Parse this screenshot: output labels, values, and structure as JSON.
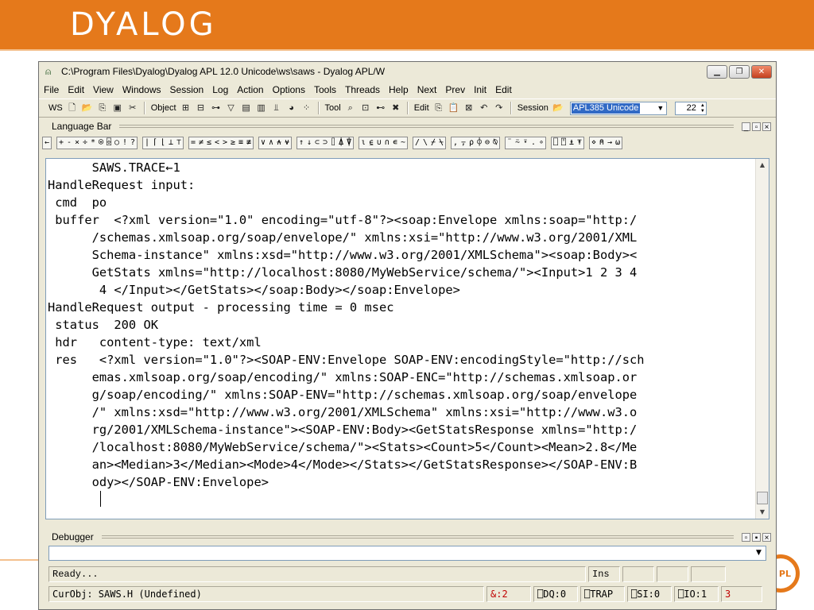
{
  "slide": {
    "logo": "DYALOG",
    "badge": "PL"
  },
  "window": {
    "title": "C:\\Program Files\\Dyalog\\Dyalog APL 12.0 Unicode\\ws\\saws - Dyalog APL/W",
    "minimize": "▁",
    "restore": "❐",
    "close": "✕"
  },
  "menu": [
    "File",
    "Edit",
    "View",
    "Windows",
    "Session",
    "Log",
    "Action",
    "Options",
    "Tools",
    "Threads",
    "Help",
    "Next",
    "Prev",
    "Init",
    "Edit"
  ],
  "toolbar": {
    "ws_label": "WS",
    "object_label": "Object",
    "tool_label": "Tool",
    "edit_label": "Edit",
    "session_label": "Session",
    "font_value": "APL385 Unicode",
    "font_size": "22"
  },
  "language_bar": {
    "title": "Language Bar",
    "groups": [
      [
        "←"
      ],
      [
        "+",
        "-",
        "×",
        "÷",
        "*",
        "⍟",
        "⌹",
        "○",
        "!",
        "?"
      ],
      [
        "|",
        "⌈",
        "⌊",
        "⊥",
        "⊤"
      ],
      [
        "=",
        "≠",
        "≤",
        "<",
        ">",
        "≥",
        "≡",
        "≢"
      ],
      [
        "∨",
        "∧",
        "⍲",
        "⍱"
      ],
      [
        "↑",
        "↓",
        "⊂",
        "⊃",
        "⌷",
        "⍋",
        "⍒"
      ],
      [
        "⍳",
        "⍷",
        "∪",
        "∩",
        "∊",
        "~"
      ],
      [
        "/",
        "\\",
        "⌿",
        "⍀"
      ],
      [
        ",",
        "⍪",
        "⍴",
        "⌽",
        "⊖",
        "⍉"
      ],
      [
        "¨",
        "⍨",
        "⍣",
        ".",
        "∘"
      ],
      [
        "⎕",
        "⍞",
        "⍎",
        "⍕"
      ],
      [
        "⋄",
        "⍝",
        "→",
        "⍵"
      ]
    ]
  },
  "session_lines": [
    "      SAWS.TRACE←1",
    "HandleRequest input:",
    " cmd  po",
    " buffer  <?xml version=\"1.0\" encoding=\"utf-8\"?><soap:Envelope xmlns:soap=\"http:/",
    "      /schemas.xmlsoap.org/soap/envelope/\" xmlns:xsi=\"http://www.w3.org/2001/XML",
    "      Schema-instance\" xmlns:xsd=\"http://www.w3.org/2001/XMLSchema\"><soap:Body><",
    "      GetStats xmlns=\"http://localhost:8080/MyWebService/schema/\"><Input>1 2 3 4",
    "       4 </Input></GetStats></soap:Body></soap:Envelope>",
    "HandleRequest output - processing time = 0 msec",
    " status  200 OK",
    " hdr   content-type: text/xml",
    " res   <?xml version=\"1.0\"?><SOAP-ENV:Envelope SOAP-ENV:encodingStyle=\"http://sch",
    "      emas.xmlsoap.org/soap/encoding/\" xmlns:SOAP-ENC=\"http://schemas.xmlsoap.or",
    "      g/soap/encoding/\" xmlns:SOAP-ENV=\"http://schemas.xmlsoap.org/soap/envelope",
    "      /\" xmlns:xsd=\"http://www.w3.org/2001/XMLSchema\" xmlns:xsi=\"http://www.w3.o",
    "      rg/2001/XMLSchema-instance\"><SOAP-ENV:Body><GetStatsResponse xmlns=\"http:/",
    "      /localhost:8080/MyWebService/schema/\"><Stats><Count>5</Count><Mean>2.8</Me",
    "      an><Median>3</Median><Mode>4</Mode></Stats></GetStatsResponse></SOAP-ENV:B",
    "      ody></SOAP-ENV:Envelope>"
  ],
  "debugger": {
    "title": "Debugger"
  },
  "status": {
    "message": "Ready...",
    "ins": "Ins",
    "cur_obj": "CurObj: SAWS.H (Undefined)",
    "and_count": "&:2",
    "dq": "⎕DQ:0",
    "trap": "⎕TRAP",
    "si": "⎕SI:0",
    "io": "⎕IO:1",
    "threads": "3"
  },
  "colors": {
    "banner": "#e5791b",
    "window_chrome": "#ece9d8",
    "selection": "#316ac5",
    "status_red": "#c00000"
  }
}
